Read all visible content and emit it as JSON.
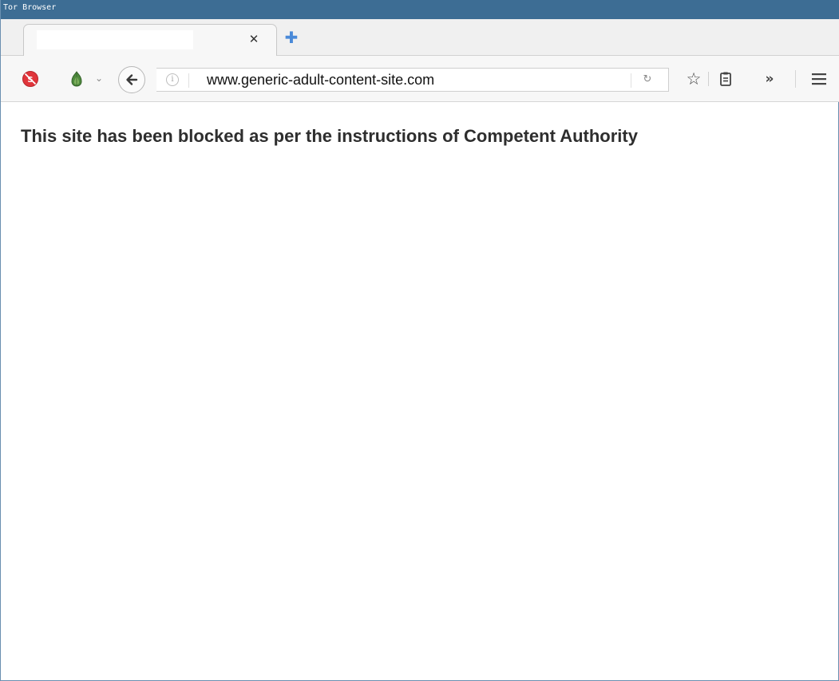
{
  "window": {
    "title": "Tor Browser"
  },
  "tab": {
    "title": "",
    "close_symbol": "✕"
  },
  "toolbar": {
    "url": "www.generic-adult-content-site.com",
    "info_symbol": "i",
    "reload_symbol": "↻",
    "bookmark_symbol": "☆",
    "overflow_symbol": "»",
    "new_tab_symbol": "✚",
    "dropdown_symbol": "⌄"
  },
  "page": {
    "message": "This site has been blocked as per the instructions of Competent Authority"
  },
  "colors": {
    "titlebar": "#3d6d94",
    "new_tab_plus": "#4a8ad8",
    "noscript_red": "#e0353b",
    "onion_green": "#4f8a3e"
  },
  "icons": {
    "noscript": "noscript-icon",
    "onion": "onion-icon",
    "back": "back-arrow-icon",
    "info": "info-icon",
    "reload": "reload-icon",
    "bookmark": "star-icon",
    "reading_list": "clipboard-icon",
    "overflow": "chevron-double-right-icon",
    "menu": "hamburger-menu-icon"
  }
}
